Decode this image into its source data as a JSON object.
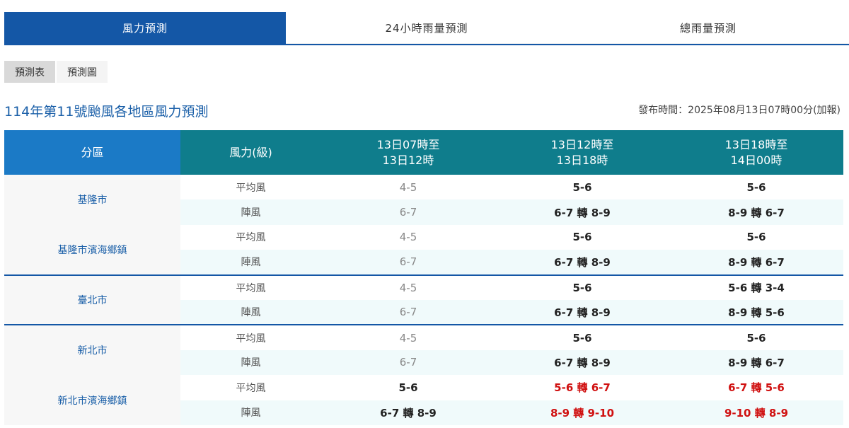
{
  "tabs": [
    "風力預測",
    "24小時雨量預測",
    "總雨量預測"
  ],
  "subtabs": [
    "預測表",
    "預測圖"
  ],
  "title": "114年第11號颱風各地區風力預測",
  "issued": "發布時間：2025年08月13日07時00分(加報)",
  "table": {
    "headers": {
      "area": "分區",
      "level": "風力(級)",
      "periods": [
        [
          "13日07時至",
          "13日12時"
        ],
        [
          "13日12時至",
          "13日18時"
        ],
        [
          "13日18時至",
          "14日00時"
        ]
      ]
    },
    "regions": [
      {
        "name": "基隆市",
        "rows": [
          {
            "kind": "平均風",
            "values": [
              "4-5",
              "5-6",
              "5-6"
            ],
            "styles": [
              "muted",
              "bold",
              "bold"
            ]
          },
          {
            "kind": "陣風",
            "values": [
              "6-7",
              "6-7 轉 8-9",
              "8-9 轉 6-7"
            ],
            "styles": [
              "muted",
              "bold",
              "bold"
            ]
          }
        ]
      },
      {
        "name": "基隆市濱海鄉鎮",
        "rows": [
          {
            "kind": "平均風",
            "values": [
              "4-5",
              "5-6",
              "5-6"
            ],
            "styles": [
              "muted",
              "bold",
              "bold"
            ]
          },
          {
            "kind": "陣風",
            "values": [
              "6-7",
              "6-7 轉 8-9",
              "8-9 轉 6-7"
            ],
            "styles": [
              "muted",
              "bold",
              "bold"
            ]
          }
        ]
      },
      {
        "name": "臺北市",
        "rows": [
          {
            "kind": "平均風",
            "values": [
              "4-5",
              "5-6",
              "5-6 轉 3-4"
            ],
            "styles": [
              "muted",
              "bold",
              "bold"
            ]
          },
          {
            "kind": "陣風",
            "values": [
              "6-7",
              "6-7 轉 8-9",
              "8-9 轉 5-6"
            ],
            "styles": [
              "muted",
              "bold",
              "bold"
            ]
          }
        ]
      },
      {
        "name": "新北市",
        "rows": [
          {
            "kind": "平均風",
            "values": [
              "4-5",
              "5-6",
              "5-6"
            ],
            "styles": [
              "muted",
              "bold",
              "bold"
            ]
          },
          {
            "kind": "陣風",
            "values": [
              "6-7",
              "6-7 轉 8-9",
              "8-9 轉 6-7"
            ],
            "styles": [
              "muted",
              "bold",
              "bold"
            ]
          }
        ]
      },
      {
        "name": "新北市濱海鄉鎮",
        "rows": [
          {
            "kind": "平均風",
            "values": [
              "5-6",
              "5-6 轉 6-7",
              "6-7 轉 5-6"
            ],
            "styles": [
              "bold",
              "alert",
              "alert"
            ]
          },
          {
            "kind": "陣風",
            "values": [
              "6-7 轉 8-9",
              "8-9 轉 9-10",
              "9-10 轉 8-9"
            ],
            "styles": [
              "bold",
              "alert",
              "alert"
            ]
          }
        ]
      }
    ],
    "separator_before": [
      2,
      3
    ],
    "colors": {
      "primary": "#1457a6",
      "header_teal": "#0f7d8c",
      "header_blue": "#1b7ac6",
      "alert": "#d01010"
    }
  }
}
